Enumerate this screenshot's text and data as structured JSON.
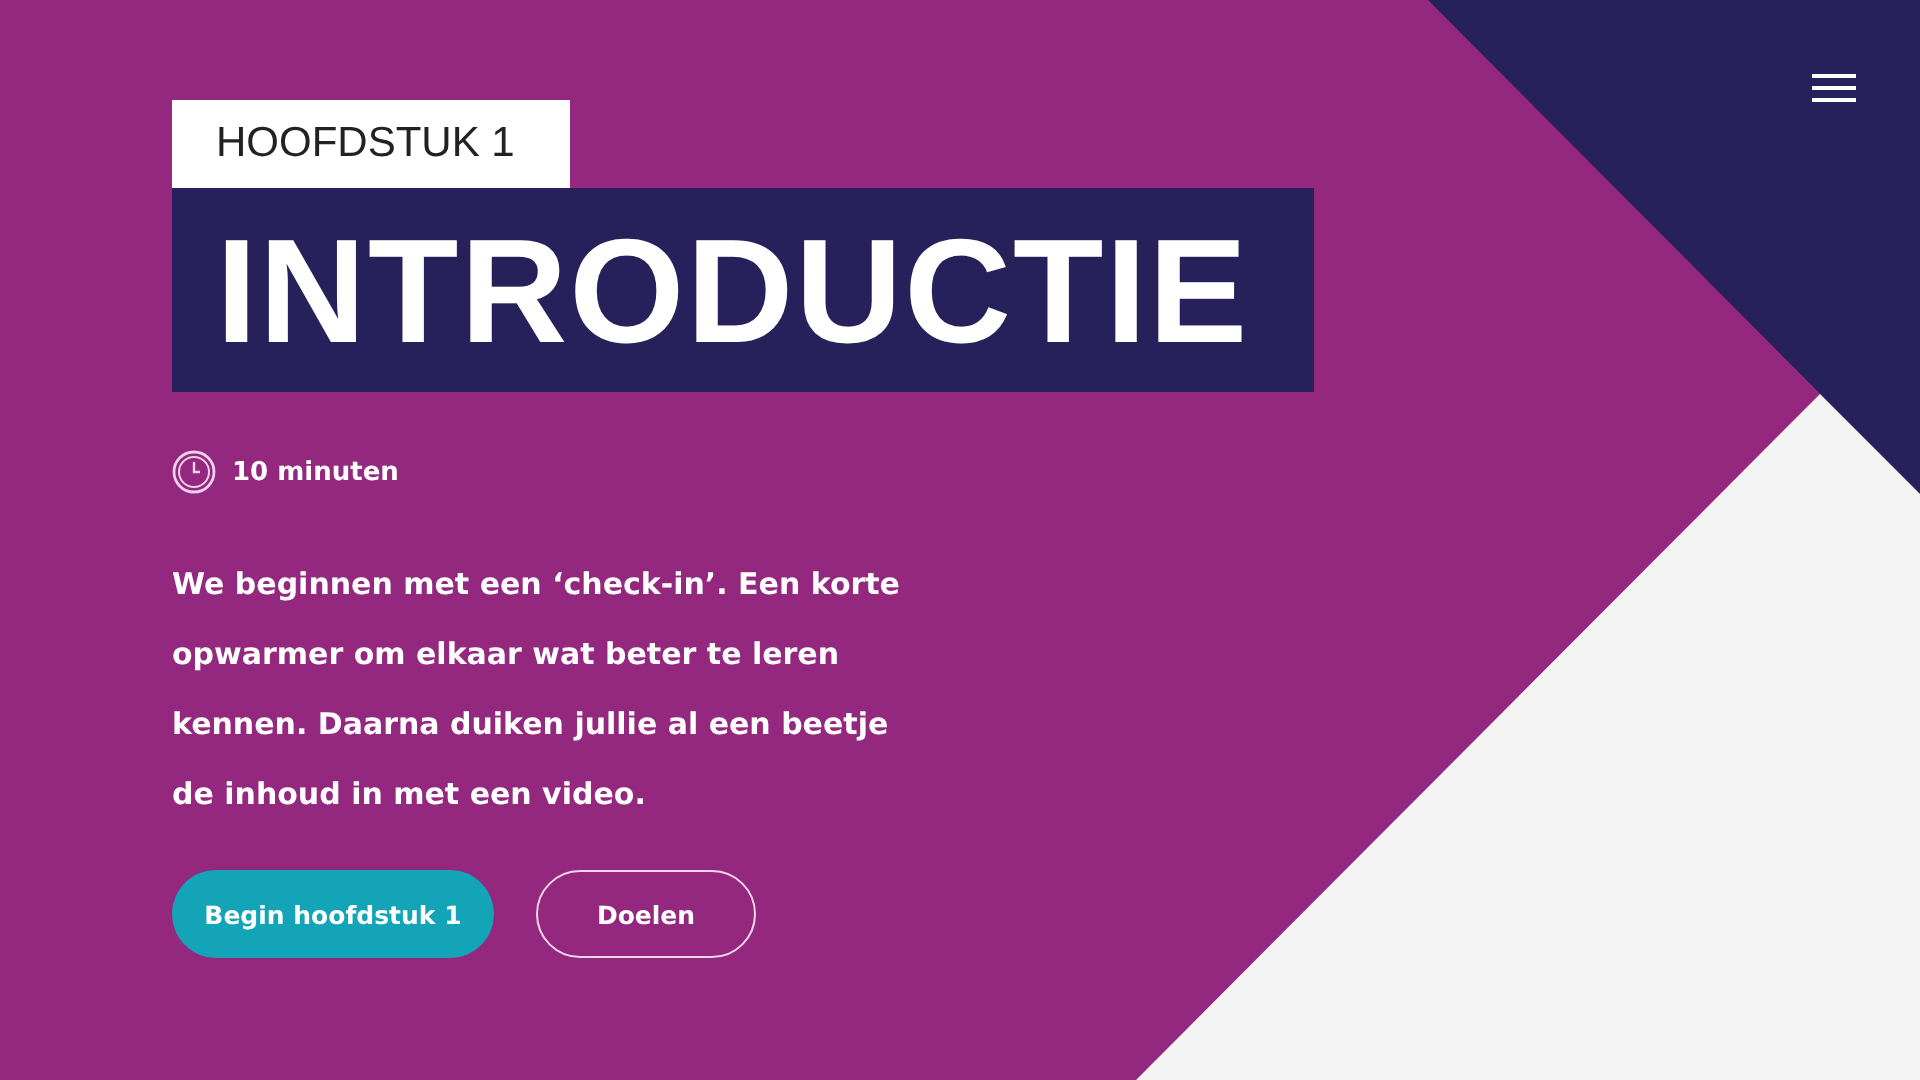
{
  "chapter_label": "HOOFDSTUK 1",
  "title": "INTRODUCTIE",
  "duration": "10 minuten",
  "description": "We beginnen met een ‘check-in’. Een korte opwarmer om elkaar wat beter te leren kennen. Daarna duiken jullie al een beetje de inhoud in met een video.",
  "buttons": [
    {
      "label": "Begin hoofdstuk 1",
      "kind": "primary"
    },
    {
      "label": "Doelen",
      "kind": "outline"
    }
  ]
}
